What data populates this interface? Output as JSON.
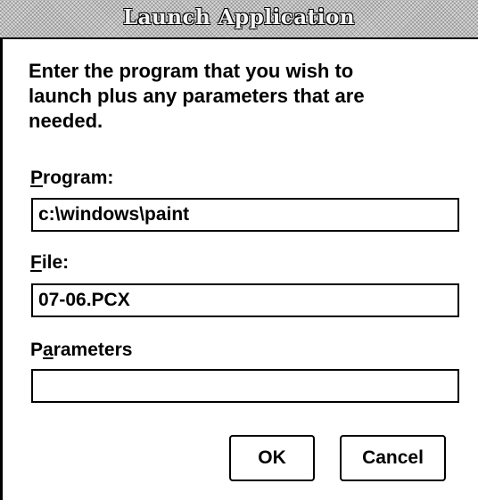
{
  "dialog": {
    "title": "Launch Application",
    "instructions": "Enter the program that you wish to\nlaunch plus any parameters that are\nneeded."
  },
  "fields": {
    "program": {
      "label_mnemonic": "P",
      "label_rest": "rogram:",
      "value": "c:\\windows\\paint"
    },
    "file": {
      "label_mnemonic": "F",
      "label_rest": "ile:",
      "value": "07-06.PCX"
    },
    "parameters": {
      "label_before": "P",
      "label_mnemonic": "a",
      "label_rest": "rameters",
      "value": ""
    }
  },
  "buttons": {
    "ok_label": "OK",
    "cancel_label": "Cancel"
  }
}
